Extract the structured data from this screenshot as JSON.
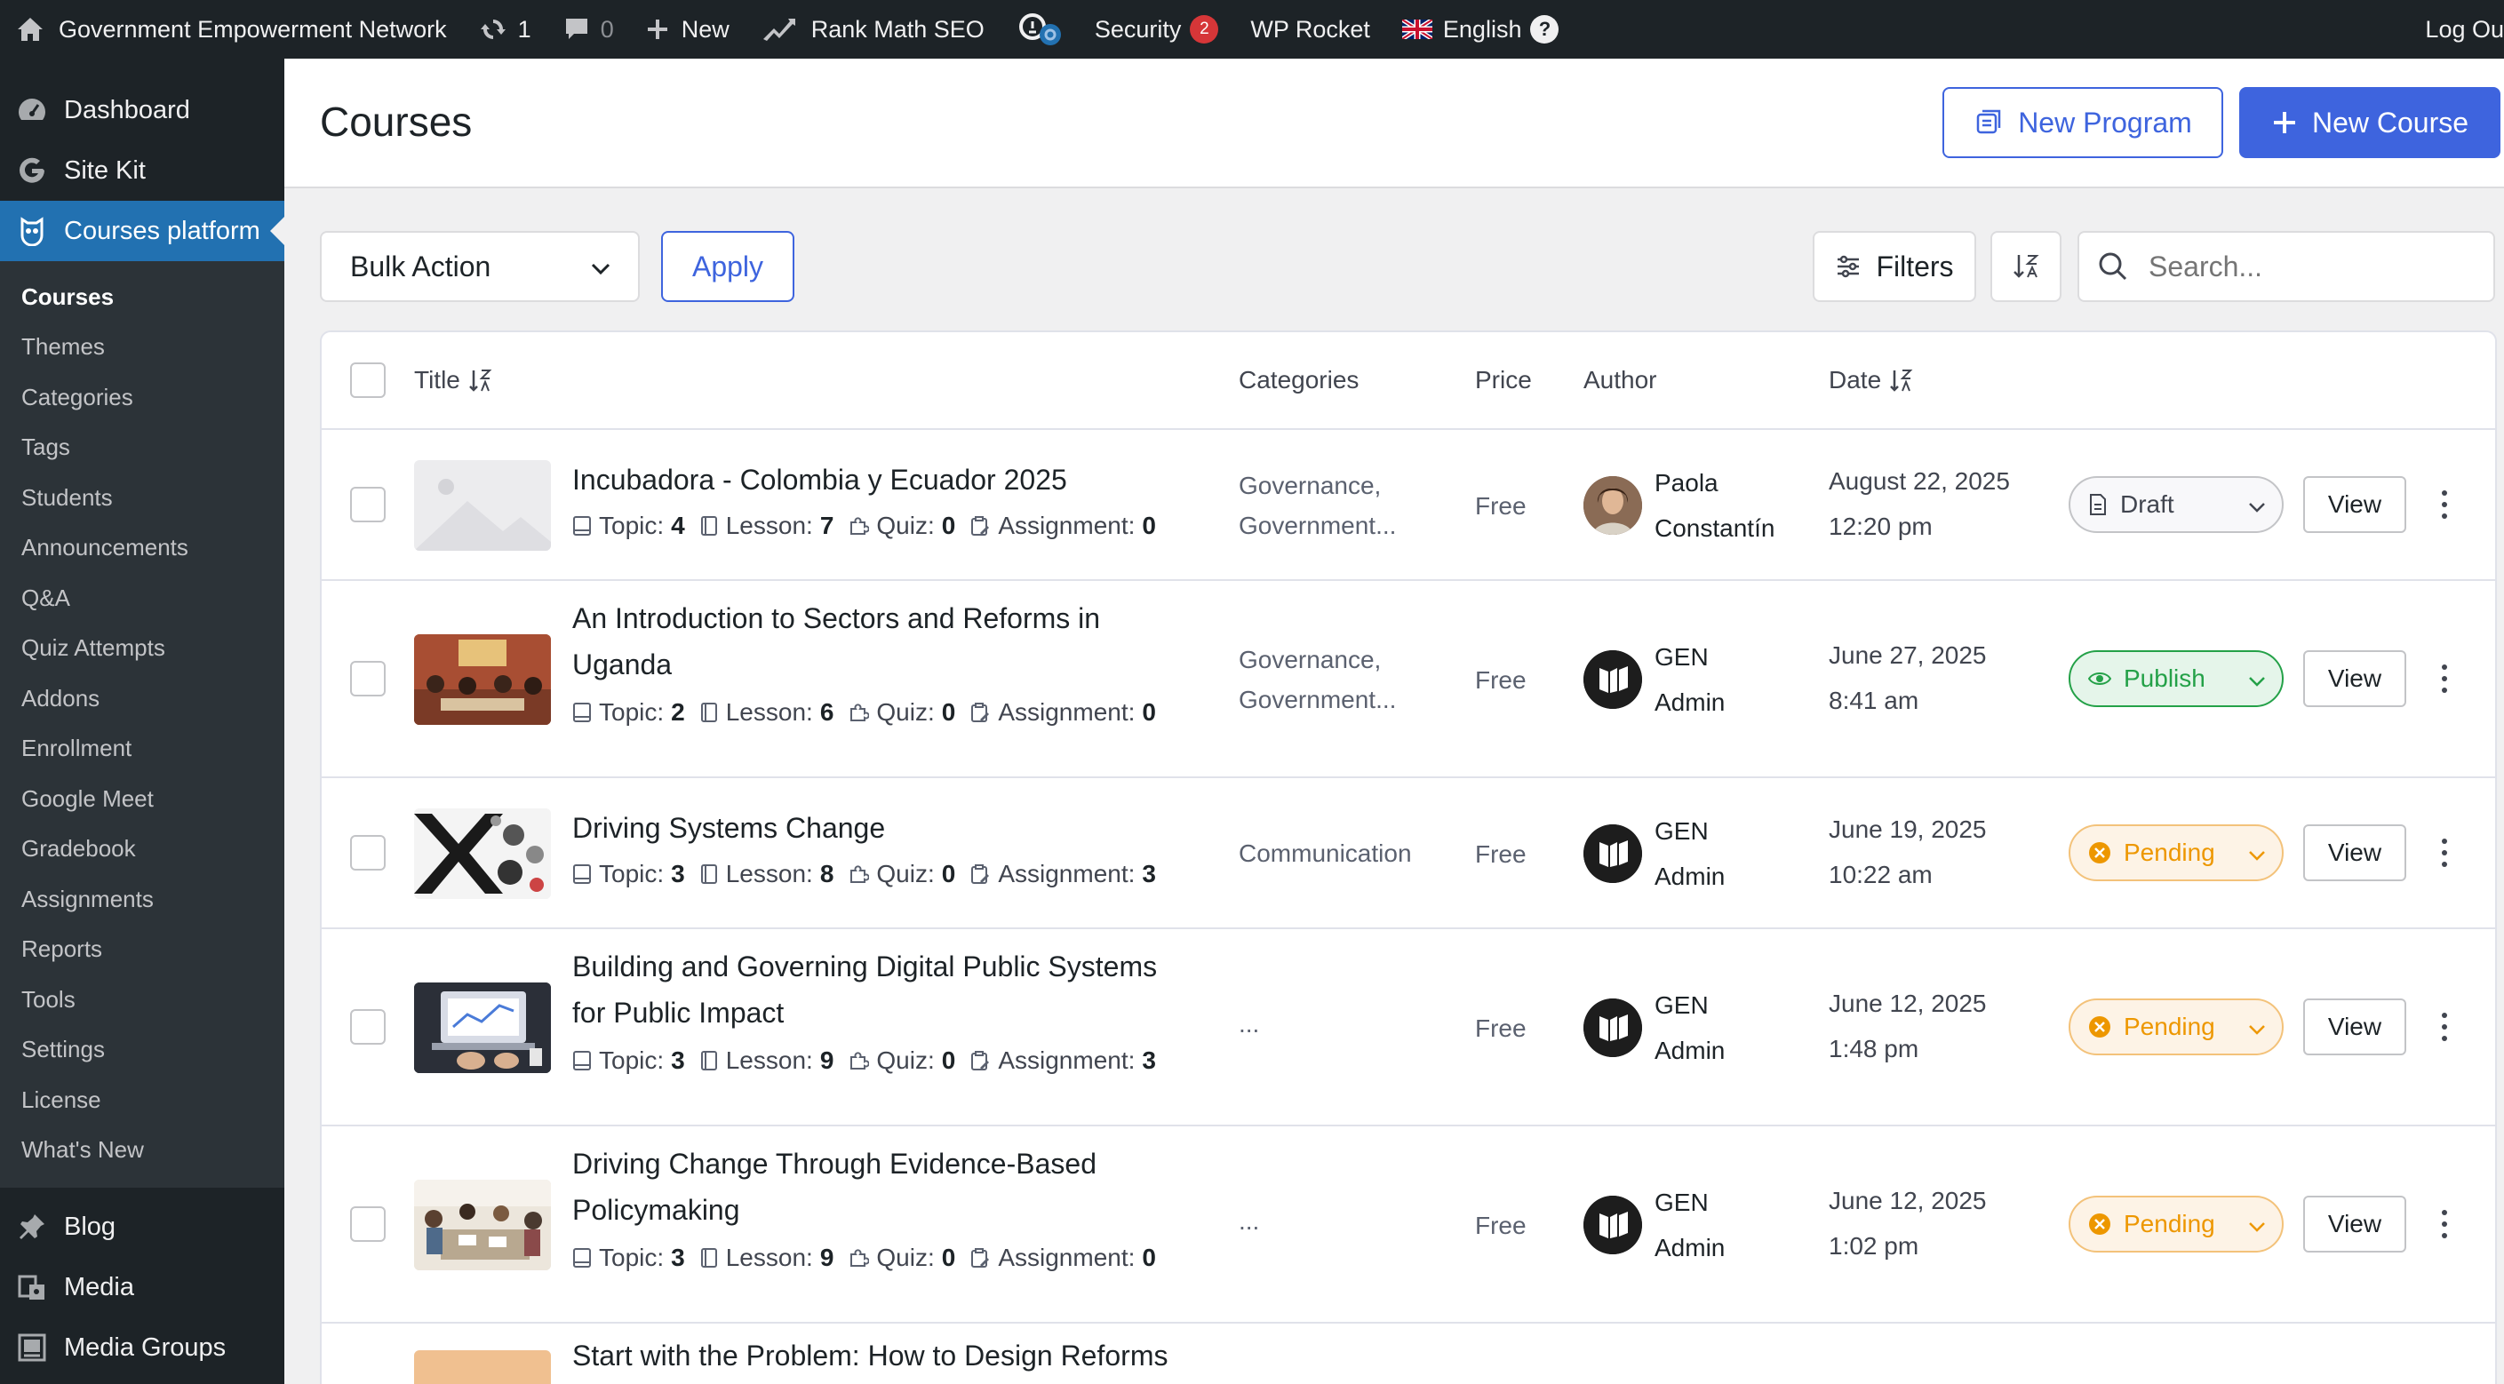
{
  "admin_bar": {
    "site_name": "Government Empowerment Network",
    "updates_count": "1",
    "comments_count": "0",
    "new_label": "New",
    "rank_math_label": "Rank Math SEO",
    "security_label": "Security",
    "security_count": "2",
    "wp_rocket_label": "WP Rocket",
    "language_label": "English",
    "help_label": "?",
    "logout_label": "Log Ou"
  },
  "sidebar": {
    "top_items": [
      {
        "label": "Dashboard",
        "icon": "dashboard-icon"
      },
      {
        "label": "Site Kit",
        "icon": "google-g-icon"
      },
      {
        "label": "Courses platform",
        "icon": "courses-owl-icon"
      }
    ],
    "submenu": [
      "Courses",
      "Themes",
      "Categories",
      "Tags",
      "Students",
      "Announcements",
      "Q&A",
      "Quiz Attempts",
      "Addons",
      "Enrollment",
      "Google Meet",
      "Gradebook",
      "Assignments",
      "Reports",
      "Tools",
      "Settings",
      "License",
      "What's New"
    ],
    "bottom_items": [
      {
        "label": "Blog",
        "icon": "pin-icon"
      },
      {
        "label": "Media",
        "icon": "media-icon"
      },
      {
        "label": "Media Groups",
        "icon": "media-groups-icon"
      }
    ]
  },
  "header": {
    "title": "Courses",
    "new_program_label": "New Program",
    "new_course_label": "New Course"
  },
  "toolbar": {
    "bulk_action_label": "Bulk Action",
    "apply_label": "Apply",
    "filters_label": "Filters",
    "search_placeholder": "Search..."
  },
  "table": {
    "columns": {
      "title": "Title",
      "categories": "Categories",
      "price": "Price",
      "author": "Author",
      "date": "Date"
    },
    "meta_labels": {
      "topic": "Topic:",
      "lesson": "Lesson:",
      "quiz": "Quiz:",
      "assignment": "Assignment:"
    },
    "view_label": "View",
    "rows": [
      {
        "title_lines": [
          "Incubadora - Colombia y Ecuador 2025"
        ],
        "topic": "4",
        "lesson": "7",
        "quiz": "0",
        "assignment": "0",
        "categories": [
          "Governance,",
          "Government..."
        ],
        "price": "Free",
        "author": [
          "Paola",
          "Constantín"
        ],
        "date": [
          "August 22, 2025",
          "12:20 pm"
        ],
        "status": "Draft"
      },
      {
        "title_lines": [
          "An Introduction to Sectors and Reforms in",
          "Uganda"
        ],
        "topic": "2",
        "lesson": "6",
        "quiz": "0",
        "assignment": "0",
        "categories": [
          "Governance,",
          "Government..."
        ],
        "price": "Free",
        "author": [
          "GEN",
          "Admin"
        ],
        "date": [
          "June 27, 2025",
          "8:41 am"
        ],
        "status": "Publish"
      },
      {
        "title_lines": [
          "Driving Systems Change"
        ],
        "topic": "3",
        "lesson": "8",
        "quiz": "0",
        "assignment": "3",
        "categories": [
          "Communication"
        ],
        "price": "Free",
        "author": [
          "GEN",
          "Admin"
        ],
        "date": [
          "June 19, 2025",
          "10:22 am"
        ],
        "status": "Pending"
      },
      {
        "title_lines": [
          "Building and Governing Digital Public Systems",
          "for Public Impact"
        ],
        "topic": "3",
        "lesson": "9",
        "quiz": "0",
        "assignment": "3",
        "categories": [
          "..."
        ],
        "price": "Free",
        "author": [
          "GEN",
          "Admin"
        ],
        "date": [
          "June 12, 2025",
          "1:48 pm"
        ],
        "status": "Pending"
      },
      {
        "title_lines": [
          "Driving Change Through Evidence-Based",
          "Policymaking"
        ],
        "topic": "3",
        "lesson": "9",
        "quiz": "0",
        "assignment": "0",
        "categories": [
          "..."
        ],
        "price": "Free",
        "author": [
          "GEN",
          "Admin"
        ],
        "date": [
          "June 12, 2025",
          "1:02 pm"
        ],
        "status": "Pending"
      },
      {
        "title_lines": [
          "Start with the Problem: How to Design Reforms"
        ]
      }
    ]
  },
  "colors": {
    "admin_dark": "#1d2327",
    "wp_blue": "#2271b1",
    "brand_blue": "#3e64de",
    "publish_green": "#24a148",
    "pending_orange": "#ed9700"
  }
}
